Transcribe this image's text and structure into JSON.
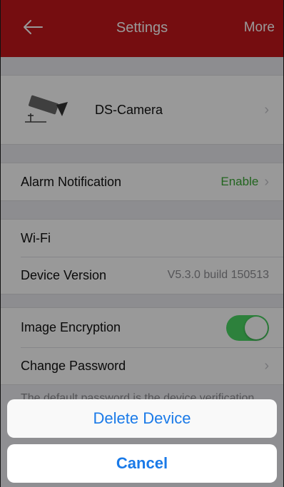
{
  "navbar": {
    "back_icon": "arrow-left-icon",
    "title": "Settings",
    "more_label": "More"
  },
  "device": {
    "icon": "camera-icon",
    "name": "DS-Camera"
  },
  "alarm": {
    "label": "Alarm Notification",
    "value": "Enable",
    "value_color": "#3aa935"
  },
  "wifi": {
    "label": "Wi-Fi"
  },
  "version": {
    "label": "Device Version",
    "value": "V5.3.0 build 150513"
  },
  "encryption": {
    "label": "Image Encryption",
    "enabled": true,
    "toggle_color": "#4bd864"
  },
  "password": {
    "label": "Change Password",
    "footnote": "The default password is the device verification code."
  },
  "action_sheet": {
    "delete_label": "Delete Device",
    "cancel_label": "Cancel",
    "button_color": "#1a7ae8"
  },
  "colors": {
    "navbar": "#c4161c"
  }
}
